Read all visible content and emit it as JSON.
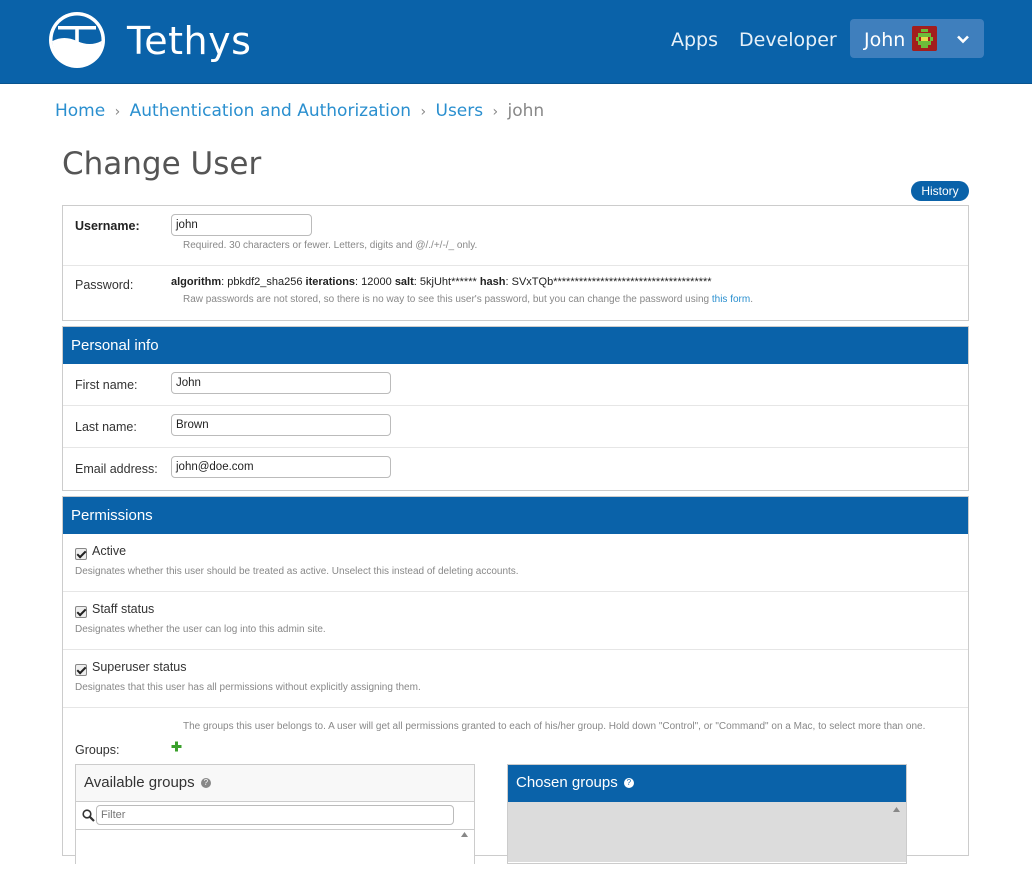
{
  "header": {
    "brand": "Tethys",
    "nav": [
      "Apps",
      "Developer"
    ],
    "user": "John"
  },
  "breadcrumb": {
    "home": "Home",
    "section": "Authentication and Authorization",
    "model": "Users",
    "current": "john",
    "separator": "›"
  },
  "page": {
    "title": "Change User",
    "history_label": "History"
  },
  "account": {
    "username_label": "Username:",
    "username_value": "john",
    "username_help": "Required. 30 characters or fewer. Letters, digits and @/./+/-/_ only.",
    "password_label": "Password:",
    "pw_algorithm_key": "algorithm",
    "pw_algorithm_val": ": pbkdf2_sha256 ",
    "pw_iterations_key": "iterations",
    "pw_iterations_val": ": 12000 ",
    "pw_salt_key": "salt",
    "pw_salt_val": ": 5kjUht****** ",
    "pw_hash_key": "hash",
    "pw_hash_val": ": SVxTQb*************************************",
    "password_help": "Raw passwords are not stored, so there is no way to see this user's password, but you can change the password using ",
    "password_help_link": "this form",
    "password_help_end": "."
  },
  "personal": {
    "heading": "Personal info",
    "first_label": "First name:",
    "first_value": "John",
    "last_label": "Last name:",
    "last_value": "Brown",
    "email_label": "Email address:",
    "email_value": "john@doe.com"
  },
  "permissions": {
    "heading": "Permissions",
    "active_label": "Active",
    "active_help": "Designates whether this user should be treated as active. Unselect this instead of deleting accounts.",
    "active_checked": true,
    "staff_label": "Staff status",
    "staff_help": "Designates whether the user can log into this admin site.",
    "staff_checked": true,
    "super_label": "Superuser status",
    "super_help": "Designates that this user has all permissions without explicitly assigning them.",
    "super_checked": true,
    "groups_help": "The groups this user belongs to. A user will get all permissions granted to each of his/her group. Hold down \"Control\", or \"Command\" on a Mac, to select more than one.",
    "groups_label": "Groups:",
    "available_groups": "Available groups",
    "filter_placeholder": "Filter",
    "chosen_groups": "Chosen groups"
  },
  "colors": {
    "brand_blue": "#0a62a9",
    "link": "#2a8fcf"
  }
}
